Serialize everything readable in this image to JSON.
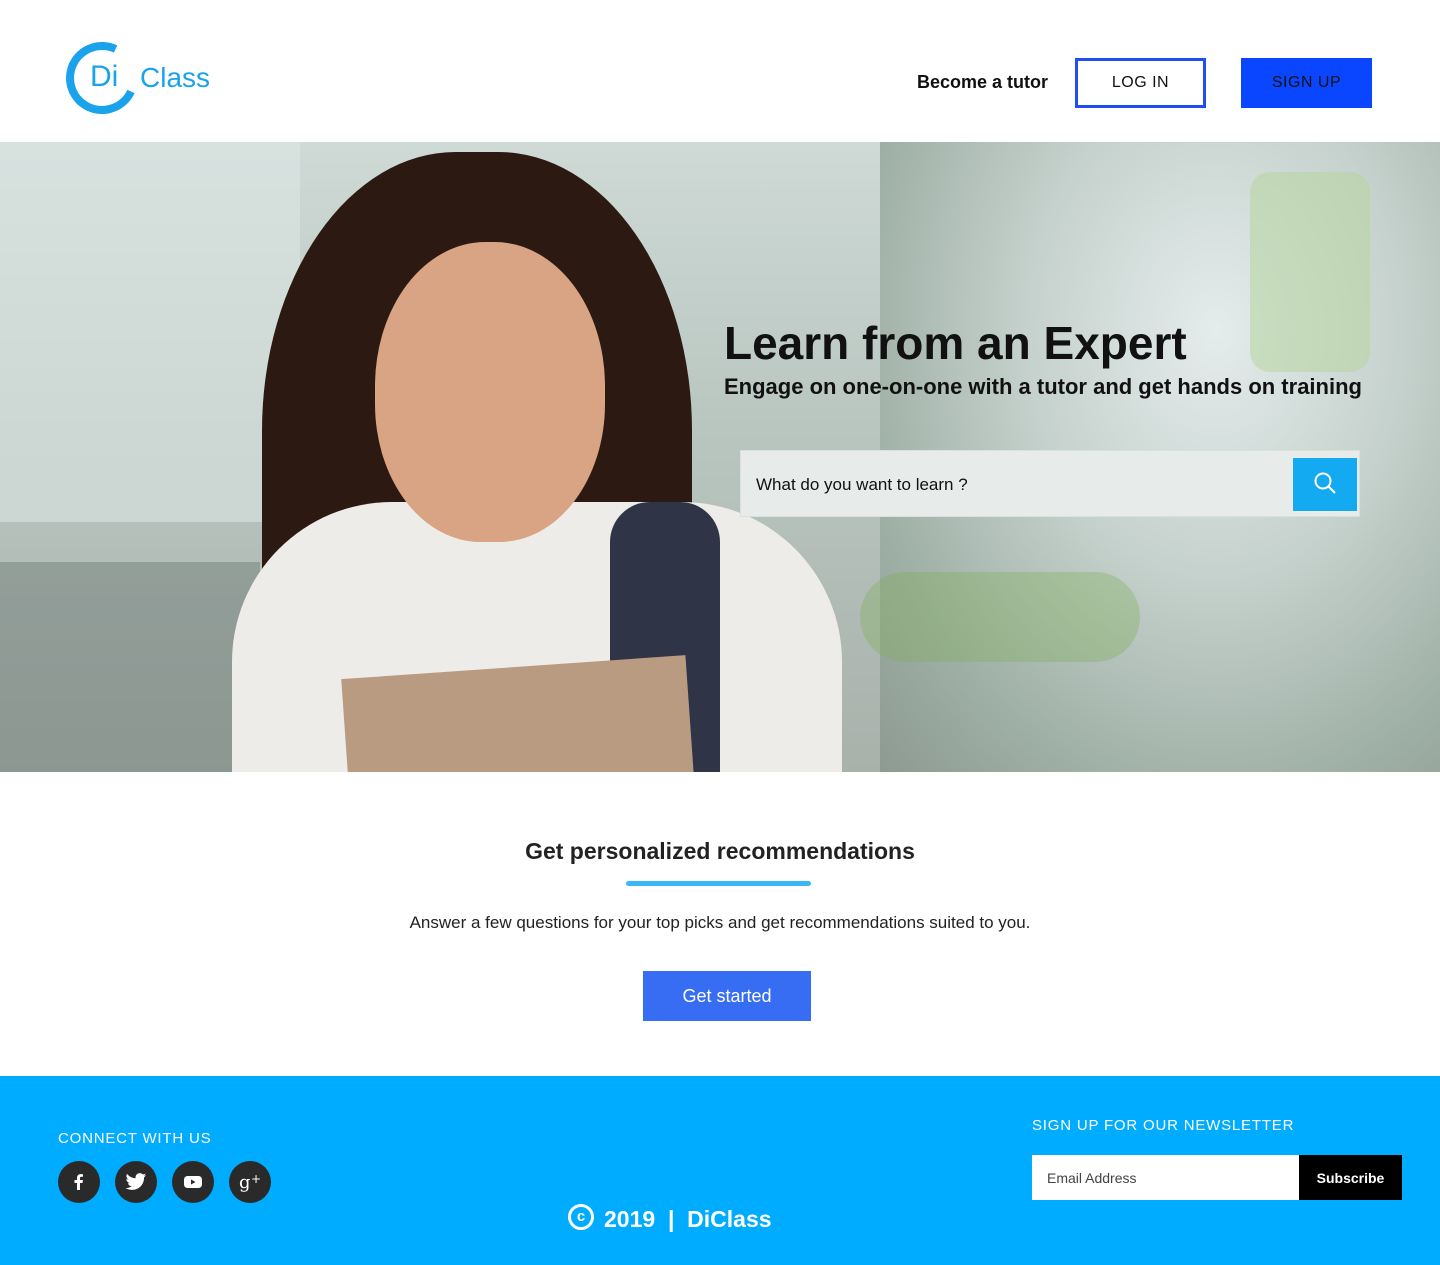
{
  "header": {
    "logo_di": "Di",
    "logo_class": "Class",
    "become_tutor": "Become a tutor",
    "login_label": "LOG IN",
    "signup_label": "SIGN UP"
  },
  "hero": {
    "title": "Learn from an Expert",
    "subtitle": "Engage on one-on-one with a tutor and get hands on training",
    "search_placeholder": "What do you want to learn ?",
    "search_icon": "search-icon"
  },
  "recommendations": {
    "title": "Get personalized recommendations",
    "text": "Answer a few questions for your top picks and  get recommendations suited to you.",
    "button_label": "Get started"
  },
  "footer": {
    "connect_label": "CONNECT WITH US",
    "socials": [
      "facebook-icon",
      "twitter-icon",
      "youtube-icon",
      "google-plus-icon"
    ],
    "copyright_symbol": "c",
    "copyright_text": "2019  |  DiClass",
    "newsletter_title": "SIGN UP FOR OUR NEWSLETTER",
    "email_placeholder": "Email Address",
    "subscribe_label": "Subscribe"
  },
  "colors": {
    "brand": "#1aa3ea",
    "signup_button": "#0a46ff",
    "cta_button": "#376df2",
    "footer_bg": "#00acff",
    "search_button": "#13aaf2"
  }
}
